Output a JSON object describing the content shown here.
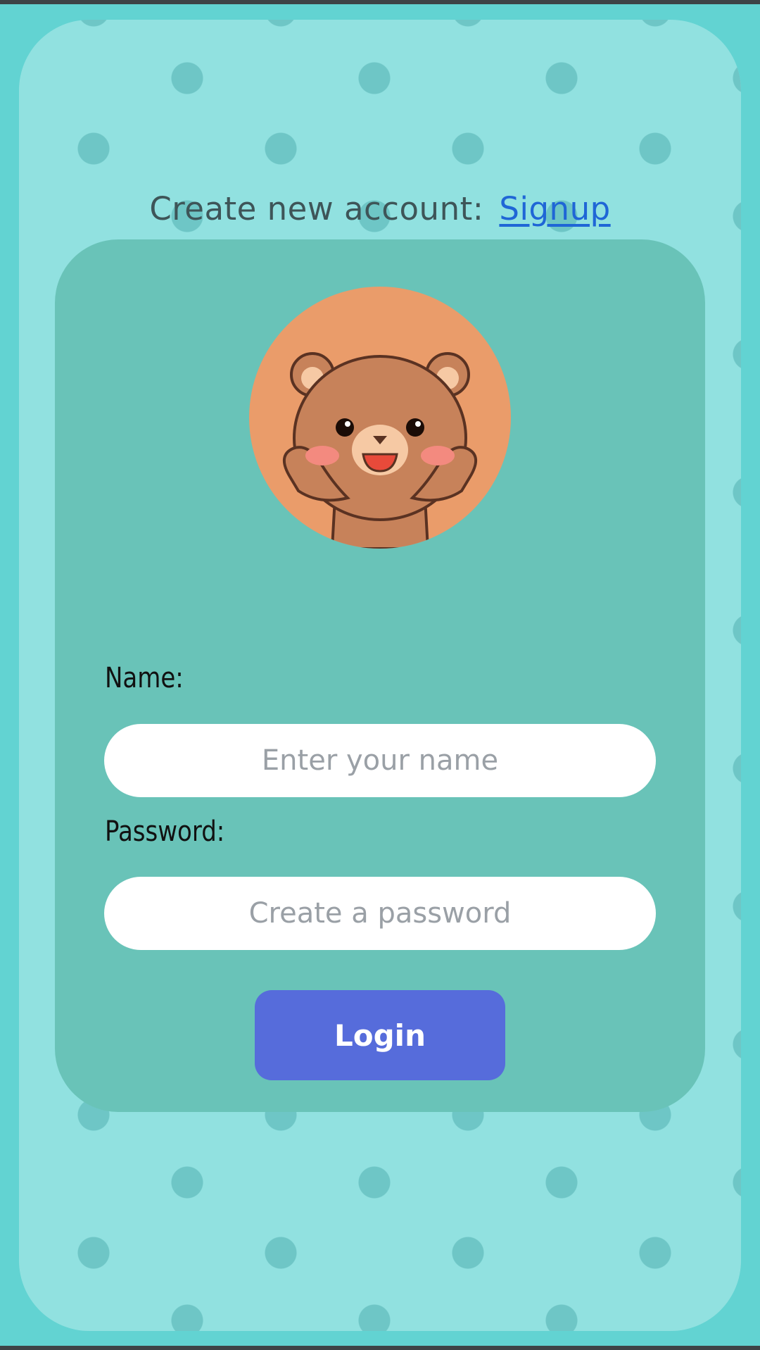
{
  "signup": {
    "prompt": "Create new account:",
    "link_label": "Signup"
  },
  "avatar": {
    "icon": "bear-icon",
    "background_color": "#ea9c6a"
  },
  "form": {
    "name_label": "Name:",
    "name_placeholder": "Enter your name",
    "password_label": "Password:",
    "password_placeholder": "Create a password",
    "login_label": "Login"
  },
  "colors": {
    "page_background": "#62d3d2",
    "frame_background": "#91e1e0",
    "card_background": "#69c3b8",
    "button": "#566cdb",
    "link": "#1f66d6"
  }
}
